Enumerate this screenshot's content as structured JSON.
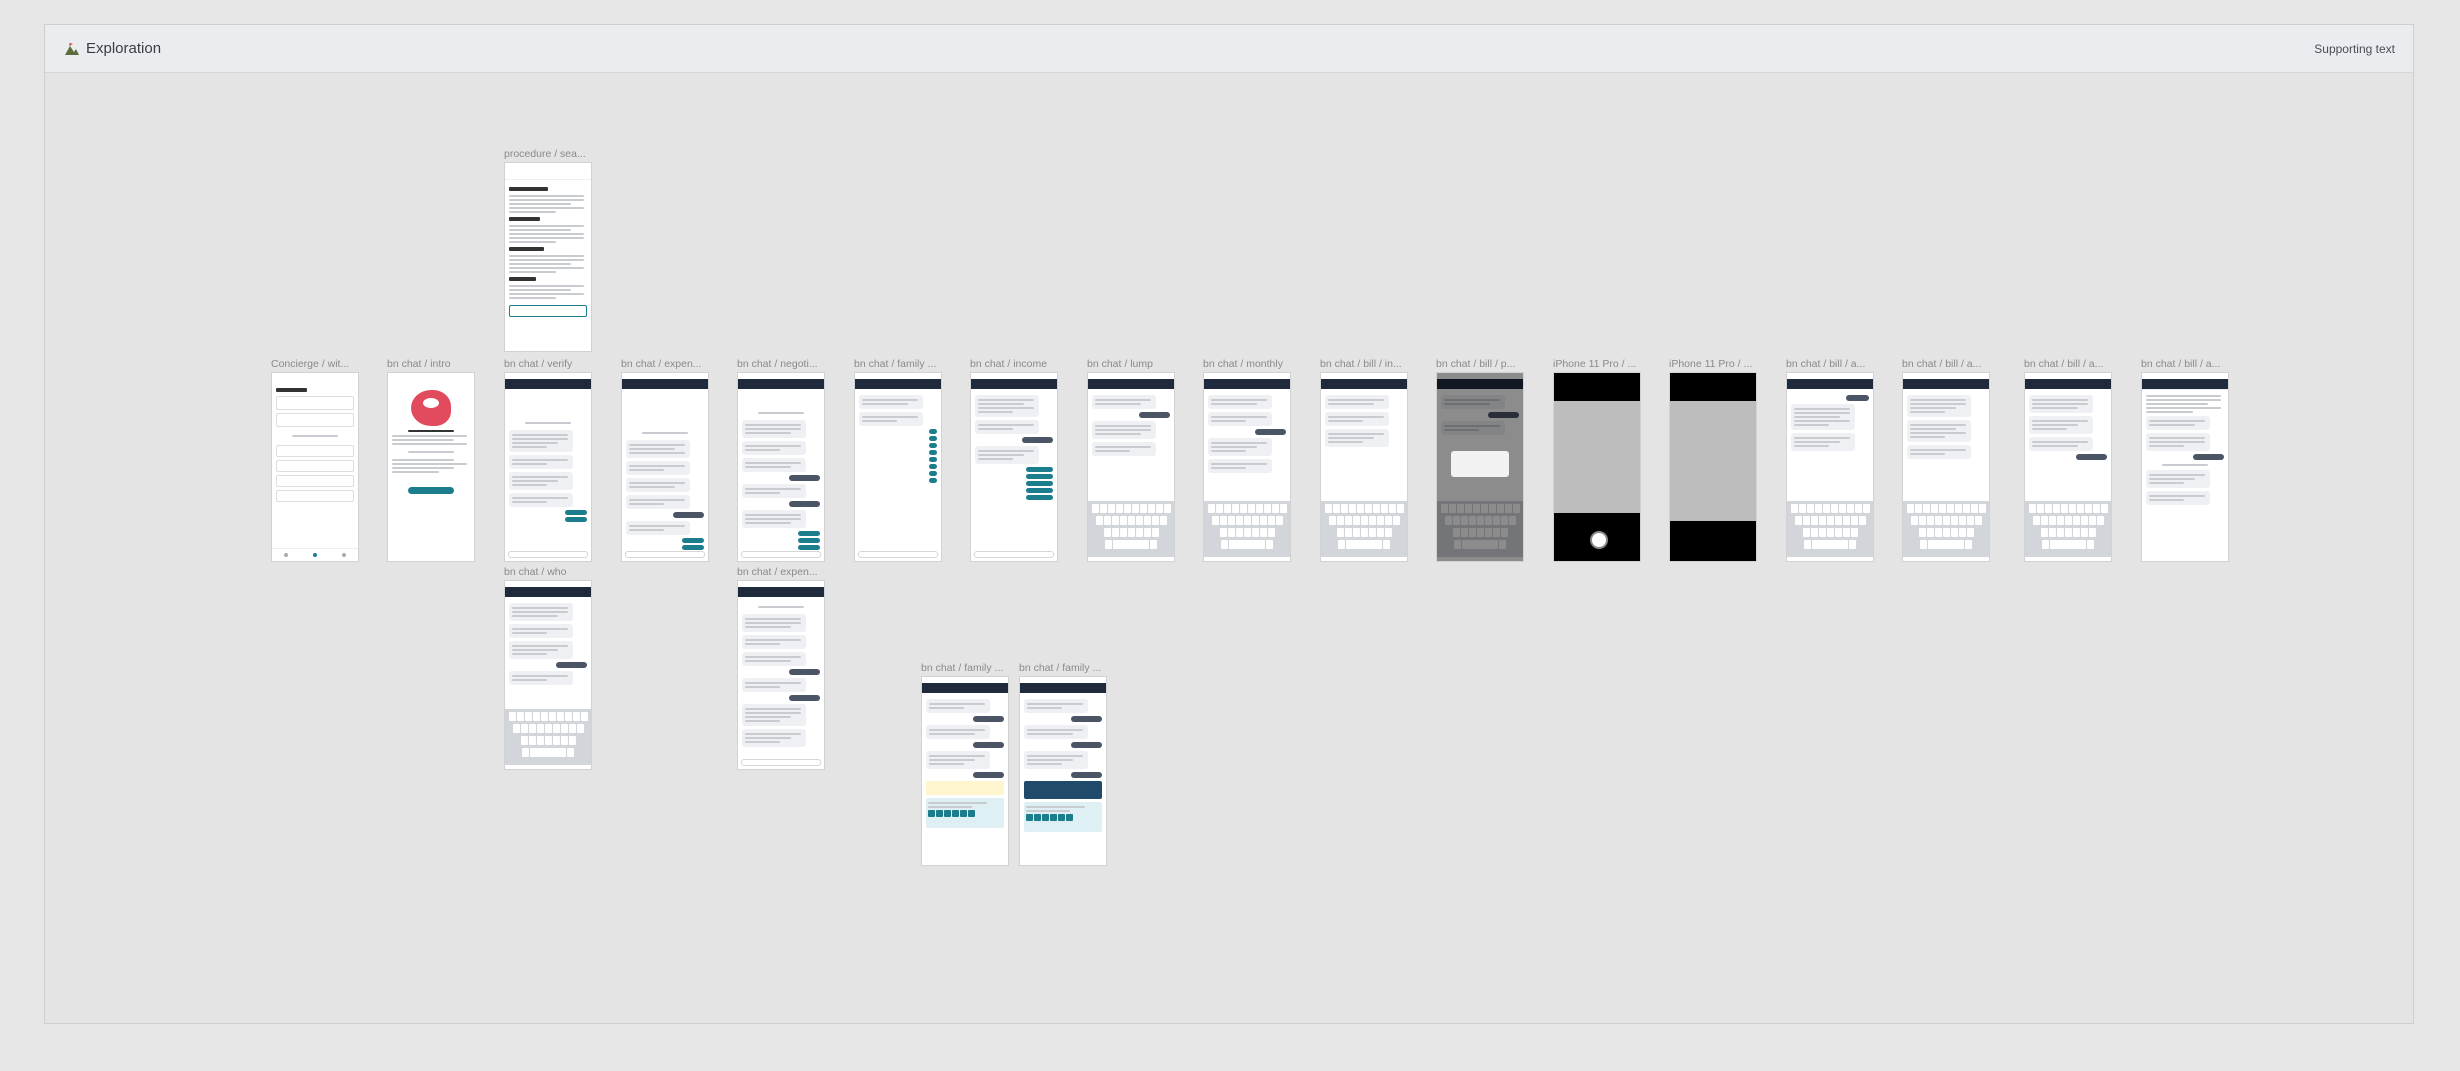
{
  "header": {
    "title": "Exploration",
    "right_text": "Supporting text",
    "icon": "mountain-flag-icon"
  },
  "frames": {
    "concierge": "Concierge / wit...",
    "intro": "bn chat / intro",
    "procedure": "procedure / sea...",
    "verify": "bn chat / verify",
    "who": "bn chat / who",
    "expen1": "bn chat / expen...",
    "negoti": "bn chat / negoti...",
    "expen2": "bn chat / expen...",
    "family1": "bn chat / family ...",
    "income": "bn chat / income",
    "lump": "bn chat / lump",
    "monthly": "bn chat / monthly",
    "bill_in": "bn chat / bill / in...",
    "bill_p": "bn chat / bill / p...",
    "iphone1": "iPhone 11 Pro / ...",
    "iphone2": "iPhone 11 Pro / ...",
    "bill_a1": "bn chat / bill / a...",
    "bill_a2": "bn chat / bill / a...",
    "bill_a3": "bn chat / bill / a...",
    "bill_a4": "bn chat / bill / a...",
    "family2": "bn chat / family ...",
    "family3": "bn chat / family ..."
  },
  "colors": {
    "nav": "#1f2b3c",
    "accent": "#1c7d8c",
    "mascot": "#e24a5e"
  }
}
